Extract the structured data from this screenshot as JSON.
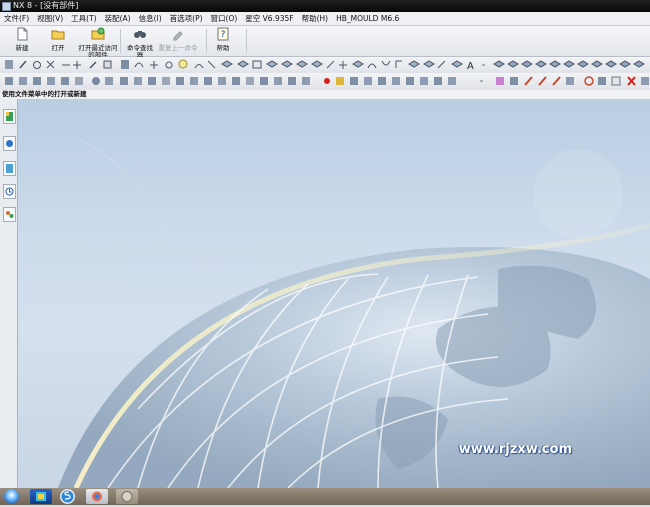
{
  "window": {
    "title": "NX 8 - [没有部件]"
  },
  "menu": [
    "文件(F)",
    "视图(V)",
    "工具(T)",
    "装配(A)",
    "信息(I)",
    "首选项(P)",
    "窗口(O)",
    "星空 V6.935F",
    "帮助(H)",
    "HB_MOULD M6.6"
  ],
  "ribbon": {
    "buttons": [
      {
        "label": "新建",
        "icon": "new-file-icon"
      },
      {
        "label": "打开",
        "icon": "open-folder-icon"
      },
      {
        "label": "打开最近访问的部件",
        "icon": "recent-files-icon"
      },
      {
        "label": "命令查找器",
        "icon": "binoculars-icon"
      },
      {
        "label": "重复上一命令",
        "icon": "repeat-command-icon"
      },
      {
        "label": "帮助",
        "icon": "help-icon"
      }
    ]
  },
  "cue_line": "使用文件菜单中的打开或新建",
  "watermark": "www.rjzxw.com",
  "colors": {
    "title_bar": "#0d0d0d",
    "canvas_sky": "#cddbec",
    "watermark": "#ffffff",
    "close_red": "#d8211b"
  }
}
